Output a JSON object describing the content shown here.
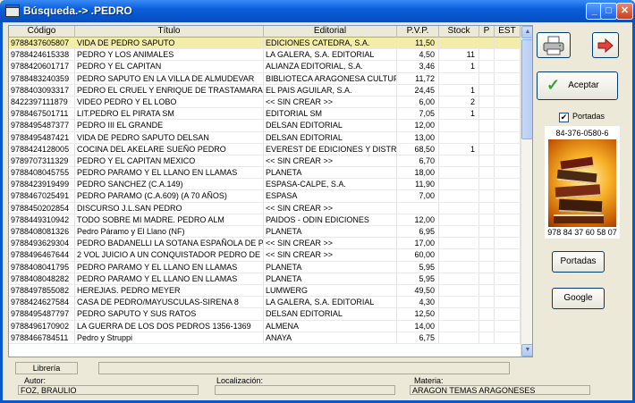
{
  "window": {
    "title": "Búsqueda.-> .PEDRO",
    "min_label": "_",
    "max_label": "□",
    "close_label": "✕"
  },
  "table": {
    "headers": {
      "code": "Código",
      "title": "Título",
      "editorial": "Editorial",
      "pvp": "P.V.P.",
      "stock": "Stock",
      "p": "P",
      "est": "EST"
    },
    "rows": [
      {
        "code": "9788437605807",
        "title": "VIDA DE PEDRO SAPUTO",
        "editorial": "EDICIONES CATEDRA, S.A.",
        "pvp": "11,50",
        "stock": "",
        "selected": true
      },
      {
        "code": "9788424615338",
        "title": "PEDRO Y LOS ANIMALES",
        "editorial": "LA GALERA, S.A. EDITORIAL",
        "pvp": "4,50",
        "stock": "11"
      },
      {
        "code": "9788420601717",
        "title": "PEDRO Y EL CAPITAN",
        "editorial": "ALIANZA EDITORIAL, S.A.",
        "pvp": "3,46",
        "stock": "1"
      },
      {
        "code": "9788483240359",
        "title": "PEDRO SAPUTO EN LA VILLA DE ALMUDEVAR",
        "editorial": "BIBLIOTECA ARAGONESA CULTUF",
        "pvp": "11,72",
        "stock": ""
      },
      {
        "code": "9788403093317",
        "title": "PEDRO EL CRUEL Y ENRIQUE DE TRASTAMARA",
        "editorial": "EL PAIS AGUILAR, S.A.",
        "pvp": "24,45",
        "stock": "1"
      },
      {
        "code": "8422397111879",
        "title": "VIDEO PEDRO Y EL LOBO",
        "editorial": "<< SIN CREAR >>",
        "pvp": "6,00",
        "stock": "2"
      },
      {
        "code": "9788467501711",
        "title": "LIT.PEDRO EL PIRATA          SM",
        "editorial": "EDITORIAL SM",
        "pvp": "7,05",
        "stock": "1"
      },
      {
        "code": "9788495487377",
        "title": "PEDRO III EL GRANDE",
        "editorial": "DELSAN EDITORIAL",
        "pvp": "12,00",
        "stock": ""
      },
      {
        "code": "9788495487421",
        "title": "VIDA DE PEDRO SAPUTO          DELSAN",
        "editorial": "DELSAN EDITORIAL",
        "pvp": "13,00",
        "stock": ""
      },
      {
        "code": "9788424128005",
        "title": "COCINA DEL AKELARE SUEÑO PEDRO",
        "editorial": "EVEREST DE EDICIONES Y DISTR",
        "pvp": "68,50",
        "stock": "1"
      },
      {
        "code": "9789707311329",
        "title": "PEDRO Y EL CAPITAN   MEXICO",
        "editorial": "<< SIN CREAR >>",
        "pvp": "6,70",
        "stock": ""
      },
      {
        "code": "9788408045755",
        "title": "PEDRO PARAMO Y EL LLANO EN LLAMAS",
        "editorial": "PLANETA",
        "pvp": "18,00",
        "stock": ""
      },
      {
        "code": "9788423919499",
        "title": "PEDRO SANCHEZ (C.A.149)",
        "editorial": "ESPASA-CALPE, S.A.",
        "pvp": "11,90",
        "stock": ""
      },
      {
        "code": "9788467025491",
        "title": "PEDRO PARAMO (C.A.609) (A 70 AÑOS)",
        "editorial": "ESPASA",
        "pvp": "7,00",
        "stock": ""
      },
      {
        "code": "9788450202854",
        "title": "DISCURSO J.L.SAN PEDRO",
        "editorial": "<< SIN CREAR >>",
        "pvp": "",
        "stock": ""
      },
      {
        "code": "9788449310942",
        "title": "TODO SOBRE MI MADRE. PEDRO ALM",
        "editorial": "PAIDOS - ODIN EDICIONES",
        "pvp": "12,00",
        "stock": ""
      },
      {
        "code": "9788408081326",
        "title": "Pedro Páramo y El Llano (NF)",
        "editorial": "PLANETA",
        "pvp": "6,95",
        "stock": ""
      },
      {
        "code": "9788493629304",
        "title": "PEDRO BADANELLI LA SOTANA ESPAÑOLA DE PE",
        "editorial": "<< SIN CREAR >>",
        "pvp": "17,00",
        "stock": ""
      },
      {
        "code": "9788496467644",
        "title": "2 VOL JUICIO A UN CONQUISTADOR PEDRO DE",
        "editorial": "<< SIN CREAR >>",
        "pvp": "60,00",
        "stock": ""
      },
      {
        "code": "9788408041795",
        "title": "PEDRO PARAMO Y EL LLANO EN LLAMAS",
        "editorial": "PLANETA",
        "pvp": "5,95",
        "stock": ""
      },
      {
        "code": "9788408048282",
        "title": "PEDRO PARAMO Y EL LLANO EN LLAMAS",
        "editorial": "PLANETA",
        "pvp": "5,95",
        "stock": ""
      },
      {
        "code": "9788497855082",
        "title": "HEREJIAS. PEDRO MEYER",
        "editorial": "LUMWERG",
        "pvp": "49,50",
        "stock": ""
      },
      {
        "code": "9788424627584",
        "title": "CASA DE PEDRO/MAYUSCULAS-SIRENA 8",
        "editorial": "LA GALERA, S.A. EDITORIAL",
        "pvp": "4,30",
        "stock": ""
      },
      {
        "code": "9788495487797",
        "title": "PEDRO SAPUTO Y SUS RATOS",
        "editorial": "DELSAN EDITORIAL",
        "pvp": "12,50",
        "stock": ""
      },
      {
        "code": "9788496170902",
        "title": "LA GUERRA DE LOS DOS PEDROS 1356-1369",
        "editorial": "ALMENA",
        "pvp": "14,00",
        "stock": ""
      },
      {
        "code": "9788466784511",
        "title": "Pedro y Struppi",
        "editorial": "ANAYA",
        "pvp": "6,75",
        "stock": ""
      }
    ]
  },
  "sidebar": {
    "accept_label": "Aceptar",
    "portadas_checkbox_label": "Portadas",
    "portadas_checked": "✔",
    "isbn_top": "84-376-0580-6",
    "isbn_bottom": "978 84 37 60 58 07",
    "portadas_button_label": "Portadas",
    "google_button_label": "Google"
  },
  "footer": {
    "libreria_label": "Librería",
    "autor_label": "Autor:",
    "autor_value": "FOZ, BRAULIO",
    "localizacion_label": "Localización:",
    "localizacion_value": "",
    "materia_label": "Materia:",
    "materia_value": "ARAGON TEMAS ARAGONESES"
  },
  "colors": {
    "titlebar": "#0a5fdc",
    "selected_row": "#f3eea6",
    "window_bg": "#ece9d8"
  }
}
